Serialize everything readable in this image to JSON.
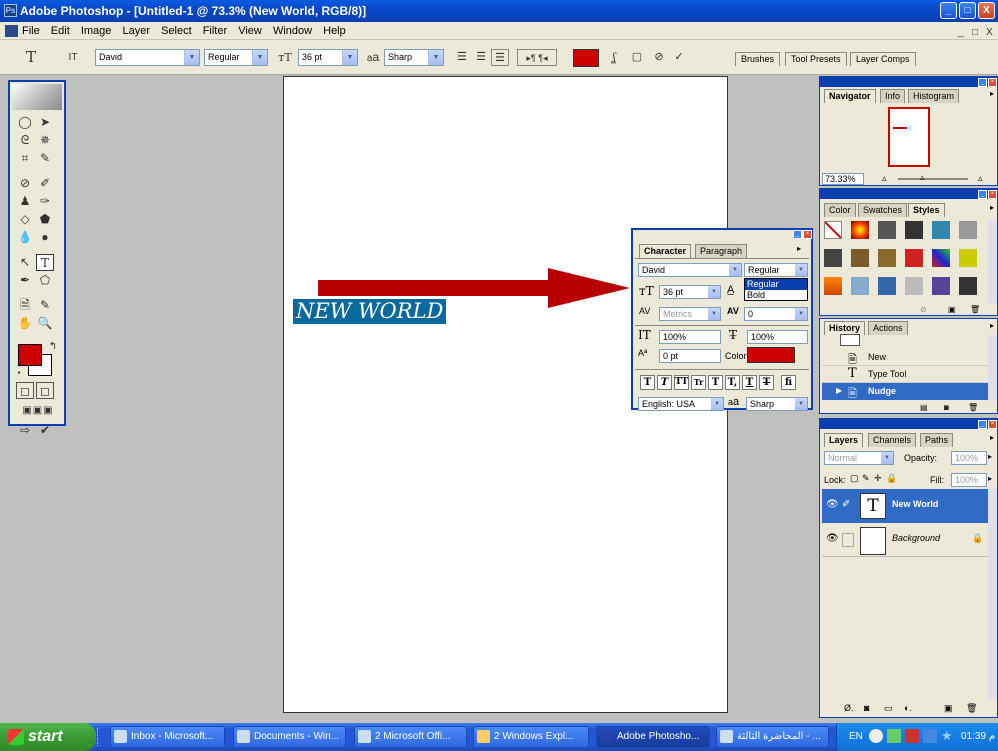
{
  "window": {
    "title": "Adobe Photoshop - [Untitled-1 @ 73.3% (New World, RGB/8)]",
    "buttons": {
      "minimize": "_",
      "maximize": "□",
      "close": "X"
    }
  },
  "menu": {
    "items": [
      "File",
      "Edit",
      "Image",
      "Layer",
      "Select",
      "Filter",
      "View",
      "Window",
      "Help"
    ],
    "doc_controls": [
      "_",
      "□",
      "X"
    ]
  },
  "options_bar": {
    "tool_icon": "T",
    "orientation_icon": "IT",
    "font_family": "David",
    "font_style": "Regular",
    "font_size": "36 pt",
    "aa_prefix": "a",
    "aa_prefix2": "a",
    "anti_alias": "Sharp",
    "text_color": "#cc0000",
    "well_tabs": [
      "Brushes",
      "Tool Presets",
      "Layer Comps"
    ]
  },
  "canvas": {
    "text": "NEW WORLD",
    "text_color": "#ffffff",
    "highlight_color": "#0a6a9e"
  },
  "toolbox": {
    "fg_color": "#cc0000",
    "bg_color": "#ffffff"
  },
  "character_panel": {
    "tabs": [
      "Character",
      "Paragraph"
    ],
    "font_family": "David",
    "font_style": "Regular",
    "style_options": [
      "Regular",
      "Bold"
    ],
    "size": "36 pt",
    "kerning": "Metrics",
    "tracking": "0",
    "vertical_scale": "100%",
    "horizontal_scale": "100%",
    "baseline_shift": "0 pt",
    "color_label": "Color:",
    "color": "#cc0000",
    "style_buttons": [
      "T",
      "T",
      "TT",
      "Tr",
      "T",
      "T,",
      "T",
      "T",
      "fi"
    ],
    "language": "English: USA",
    "aa_prefix": "a",
    "aa_prefix2": "a",
    "anti_alias": "Sharp"
  },
  "navigator_panel": {
    "tabs": [
      "Navigator",
      "Info",
      "Histogram"
    ],
    "zoom": "73.33%"
  },
  "styles_panel": {
    "tabs": [
      "Color",
      "Swatches",
      "Styles"
    ]
  },
  "history_panel": {
    "tabs": [
      "History",
      "Actions"
    ],
    "items": [
      {
        "label": "New",
        "icon": "document-icon"
      },
      {
        "label": "Type Tool",
        "icon": "type-icon"
      },
      {
        "label": "Nudge",
        "icon": "document-icon",
        "selected": true
      }
    ]
  },
  "layers_panel": {
    "tabs": [
      "Layers",
      "Channels",
      "Paths"
    ],
    "blend_mode": "Normal",
    "opacity_label": "Opacity:",
    "opacity": "100%",
    "lock_label": "Lock:",
    "fill_label": "Fill:",
    "fill": "100%",
    "layers": [
      {
        "name": "New World",
        "type": "text",
        "thumb": "T",
        "selected": true
      },
      {
        "name": "Background",
        "type": "image",
        "locked": true
      }
    ]
  },
  "taskbar": {
    "start_label": "start",
    "tasks": [
      "Inbox - Microsoft...",
      "Documents - Win...",
      "2 Microsoft Offi...",
      "2 Windows Expl...",
      "Adobe Photosho...",
      "المحاضرة الثالثة - ..."
    ],
    "language": "EN",
    "time": "01:39 م"
  }
}
